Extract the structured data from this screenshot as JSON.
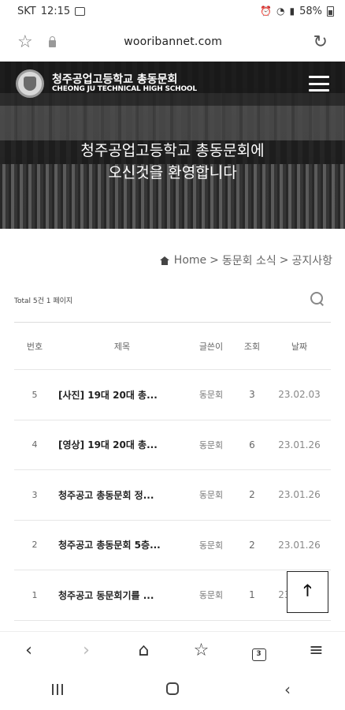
{
  "statusbar": {
    "carrier": "SKT",
    "time": "12:15",
    "battery": "58%"
  },
  "browser": {
    "url": "wooribannet.com"
  },
  "header": {
    "school_kr": "청주공업고등학교 총동문회",
    "school_en": "CHEONG JU TECHNICAL HIGH SCHOOL",
    "welcome_line1": "청주공업고등학교 총동문회에",
    "welcome_line2": "오신것을 환영합니다"
  },
  "breadcrumb": {
    "home": "Home",
    "sep": ">",
    "section": "동문회 소식",
    "page": "공지사항"
  },
  "board": {
    "total": "Total 5건 1 페이지",
    "columns": {
      "no": "번호",
      "title": "제목",
      "author": "글쓴이",
      "views": "조회",
      "date": "날짜"
    },
    "rows": [
      {
        "no": "5",
        "title": "[사진] 19대 20대 총...",
        "author": "동문회",
        "views": "3",
        "date": "23.02.03"
      },
      {
        "no": "4",
        "title": "[영상] 19대 20대 총...",
        "author": "동문회",
        "views": "6",
        "date": "23.01.26"
      },
      {
        "no": "3",
        "title": "청주공고 총동문회 정...",
        "author": "동문회",
        "views": "2",
        "date": "23.01.26"
      },
      {
        "no": "2",
        "title": "청주공고 총동문회 5층...",
        "author": "동문회",
        "views": "2",
        "date": "23.01.26"
      },
      {
        "no": "1",
        "title": "청주공고 동문회기를 ...",
        "author": "동문회",
        "views": "1",
        "date": "23.01.26"
      }
    ]
  },
  "toolbar": {
    "tabs_count": "3"
  }
}
